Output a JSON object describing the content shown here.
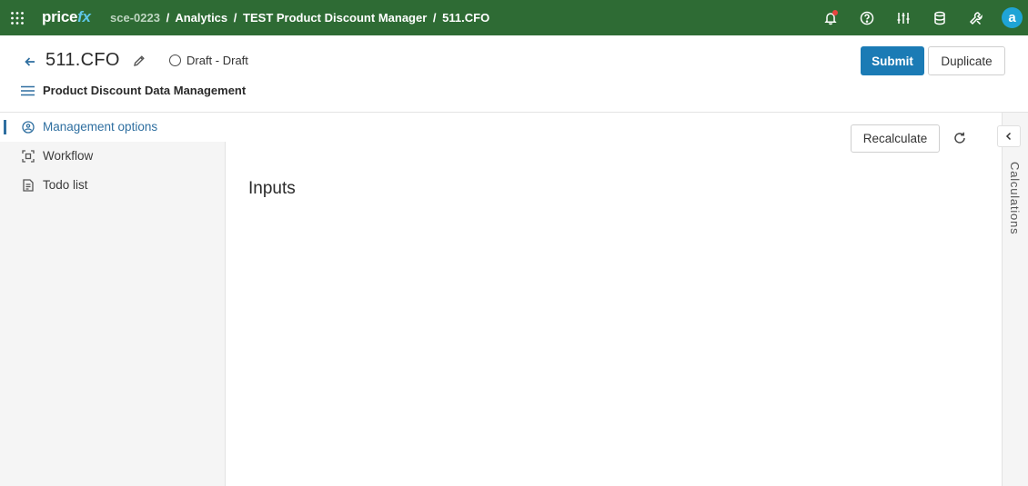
{
  "topbar": {
    "logo_price": "price",
    "logo_fx": "fx",
    "breadcrumb": {
      "instance": "sce-0223",
      "sep": "/",
      "items": [
        "Analytics",
        "TEST Product Discount Manager",
        "511.CFO"
      ]
    },
    "icons": [
      "apps-grid-icon",
      "bell-icon",
      "help-icon",
      "sliders-icon",
      "database-icon",
      "wrench-icon"
    ],
    "avatar_letter": "a",
    "colors": {
      "bar": "#2e6b34",
      "avatar": "#1fa4d6",
      "notification": "#e8433f"
    }
  },
  "header": {
    "title": "511.CFO",
    "status": "Draft - Draft",
    "subtitle": "Product Discount Data Management",
    "submit_label": "Submit",
    "duplicate_label": "Duplicate",
    "accent": "#1b7bb5"
  },
  "sidebar": {
    "items": [
      {
        "label": "Management options",
        "icon": "settings-users-icon",
        "active": true
      },
      {
        "label": "Workflow",
        "icon": "workflow-icon",
        "active": false
      },
      {
        "label": "Todo list",
        "icon": "todo-list-icon",
        "active": false
      }
    ]
  },
  "main": {
    "recalculate_label": "Recalculate",
    "section_title": "Inputs"
  },
  "right_panel": {
    "label": "Calculations"
  }
}
